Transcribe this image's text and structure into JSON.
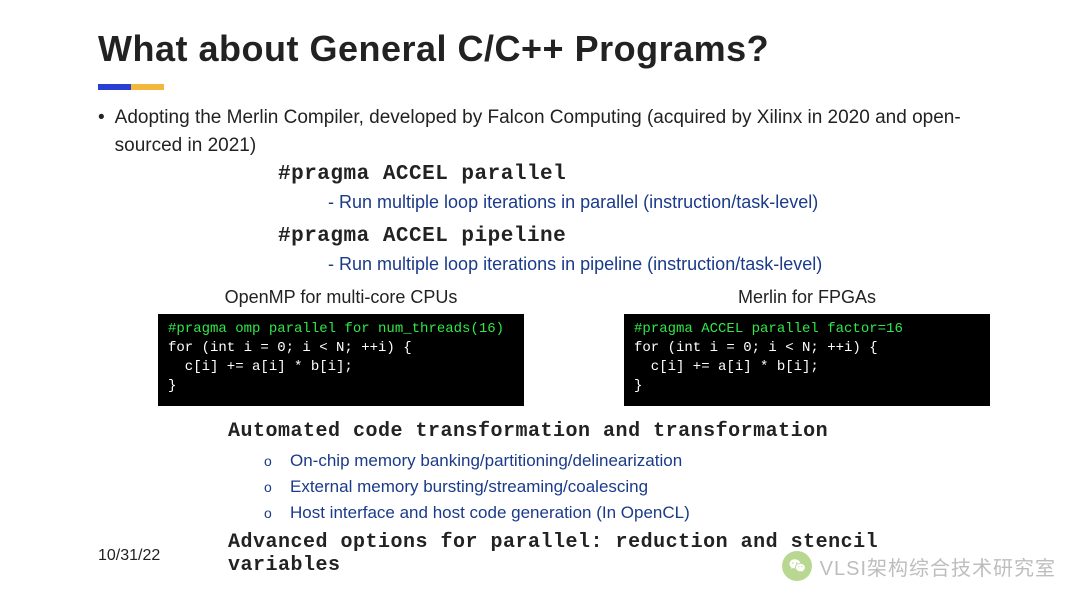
{
  "title": "What about General C/C++ Programs?",
  "bullet": "Adopting the Merlin Compiler, developed by Falcon Computing (acquired by Xilinx in 2020 and open-sourced in 2021)",
  "pragma1": {
    "code": "#pragma ACCEL parallel",
    "desc": "- Run multiple loop iterations in parallel (instruction/task-level)"
  },
  "pragma2": {
    "code": "#pragma ACCEL pipeline",
    "desc": "- Run multiple loop iterations in pipeline (instruction/task-level)"
  },
  "columns": {
    "left": {
      "title": "OpenMP for multi-core CPUs",
      "code_pragma": "#pragma omp parallel for num_threads(16)",
      "code_body": "for (int i = 0; i < N; ++i) {\n  c[i] += a[i] * b[i];\n}"
    },
    "right": {
      "title": "Merlin for FPGAs",
      "code_pragma": "#pragma ACCEL parallel factor=16",
      "code_body": "for (int i = 0; i < N; ++i) {\n  c[i] += a[i] * b[i];\n}"
    }
  },
  "auto_heading": "Automated code transformation and transformation",
  "auto_items": [
    "On-chip memory banking/partitioning/delinearization",
    "External memory bursting/streaming/coalescing",
    "Host interface and host code generation (In OpenCL)"
  ],
  "advanced": "Advanced options for parallel:  reduction and stencil variables",
  "date": "10/31/22",
  "watermark": "VLSI架构综合技术研究室"
}
